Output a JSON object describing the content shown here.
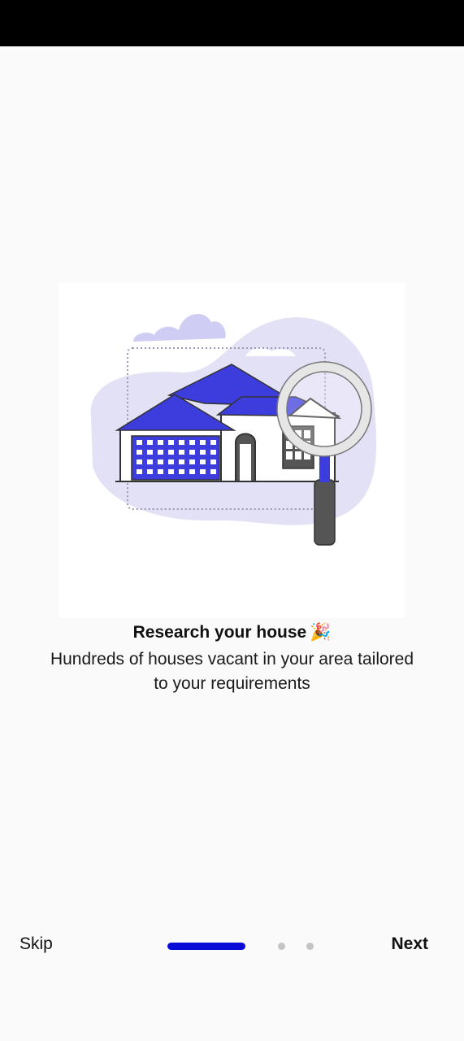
{
  "onboarding": {
    "title": "Research your house",
    "title_emoji": "🎉",
    "subtitle": "Hundreds of houses vacant in your area tailored to your requirements",
    "illustration_icon": "house-search-illustration"
  },
  "footer": {
    "skip_label": "Skip",
    "next_label": "Next"
  },
  "pager": {
    "total_pages": 3,
    "current_page": 1
  },
  "colors": {
    "accent": "#0a0ad8",
    "inactive_dot": "#c4c4c4",
    "illustration_blue": "#3d3ddd",
    "illustration_blob": "#e3e1f6"
  }
}
